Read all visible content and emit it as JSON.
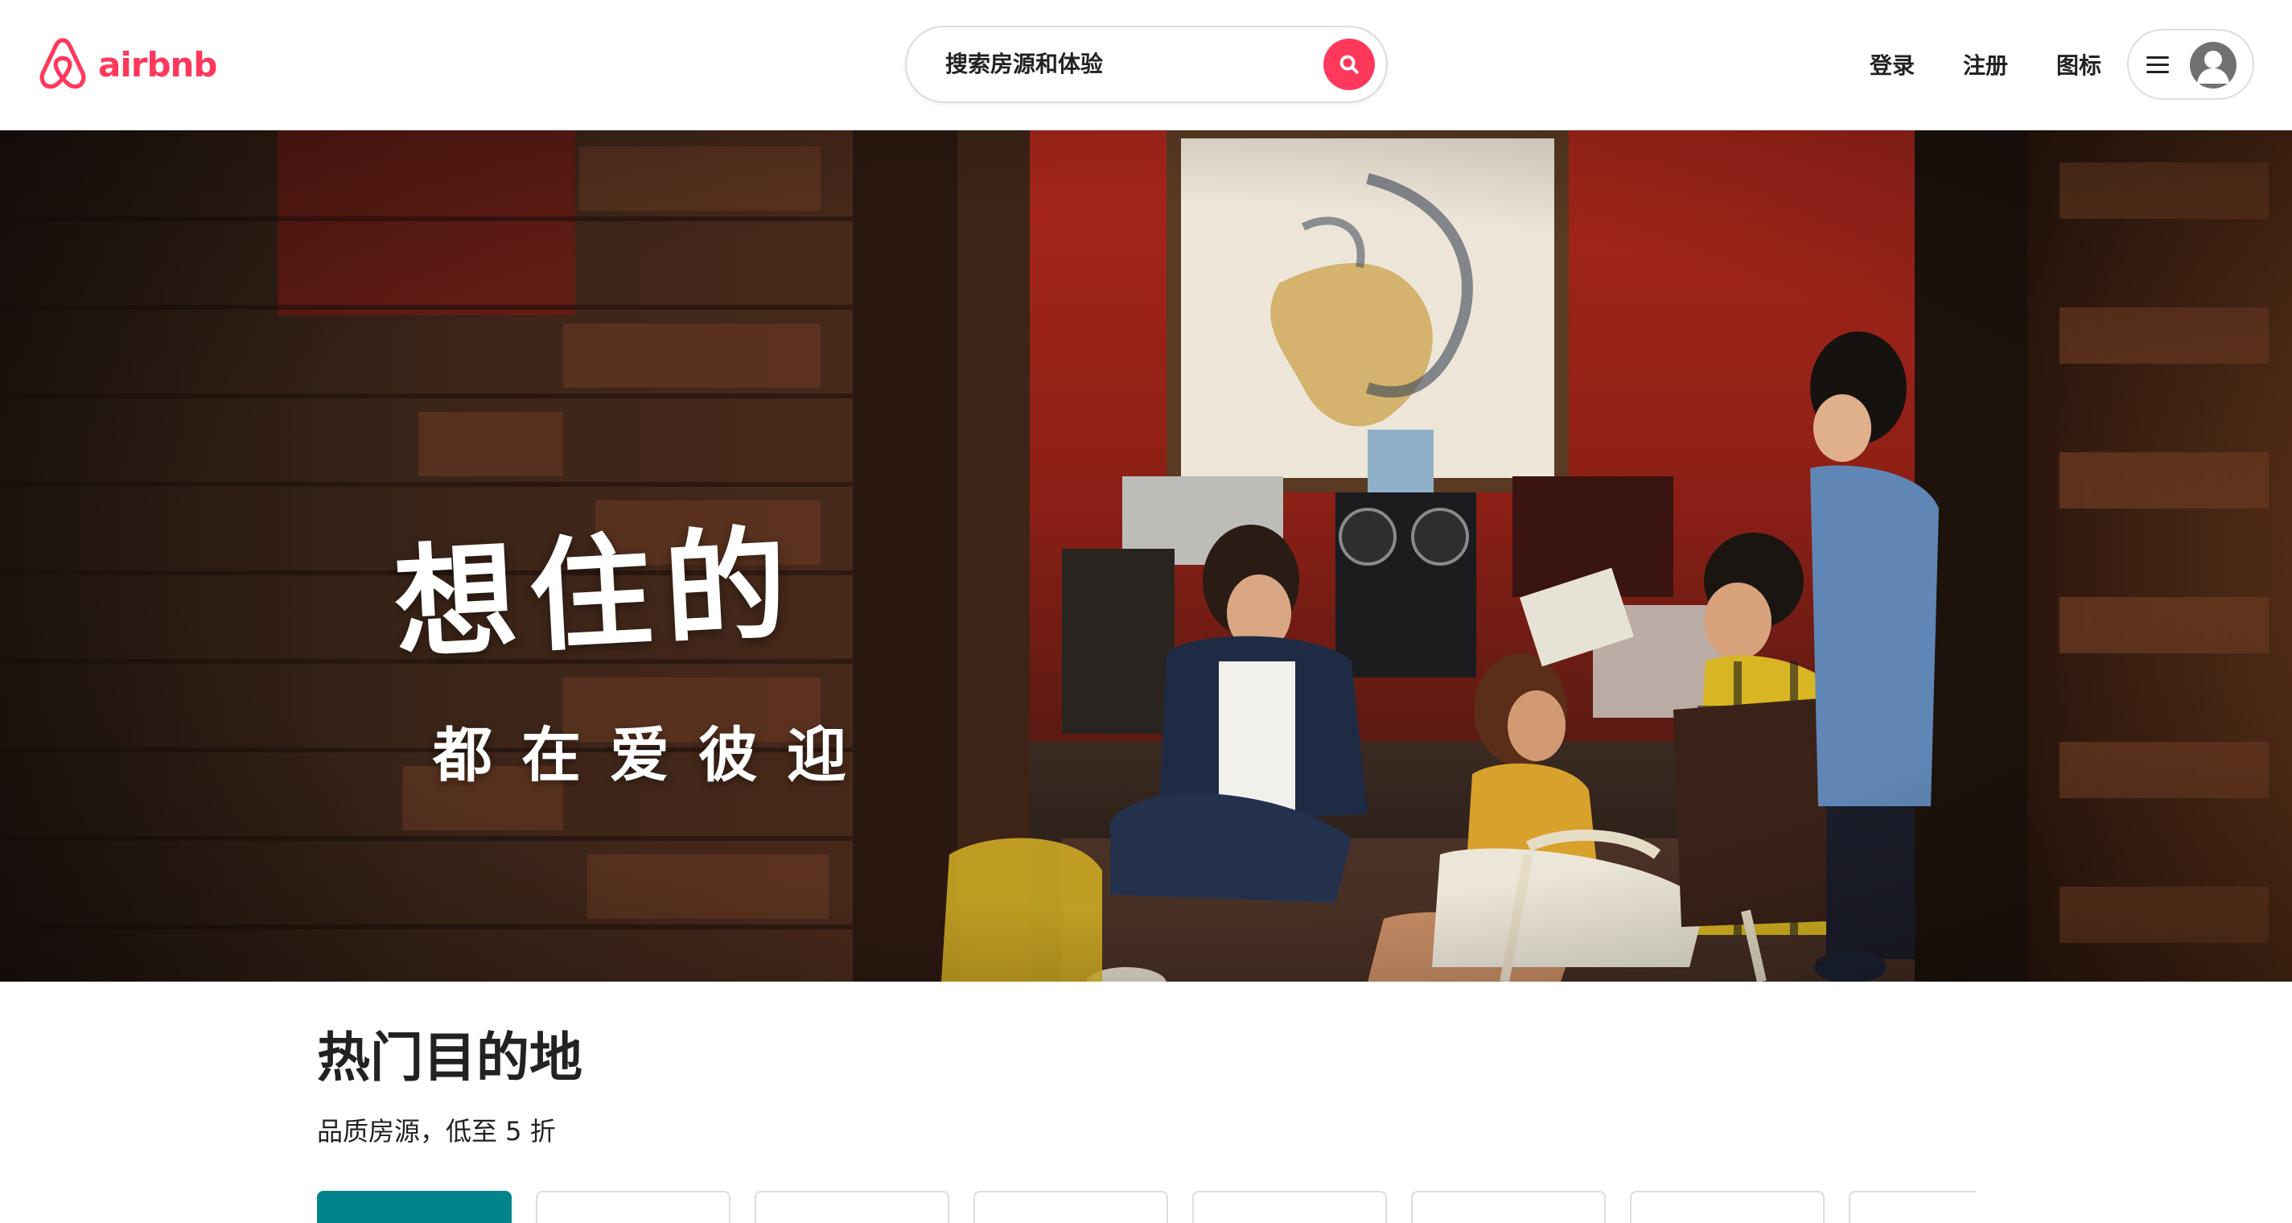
{
  "brand": {
    "name": "airbnb",
    "accent_color": "#ff385c"
  },
  "search": {
    "placeholder": "搜索房源和体验",
    "button_icon": "search-icon"
  },
  "nav": {
    "login": "登录",
    "signup": "注册",
    "icons": "图标",
    "menu_icon": "hamburger-icon",
    "avatar_icon": "user-avatar-icon"
  },
  "hero": {
    "title": "想住的",
    "subtitle": "都在爱彼迎"
  },
  "destinations": {
    "title": "热门目的地",
    "subtitle": "品质房源，低至 5 折",
    "active_tab_color": "#008489",
    "tab_count": 8
  }
}
